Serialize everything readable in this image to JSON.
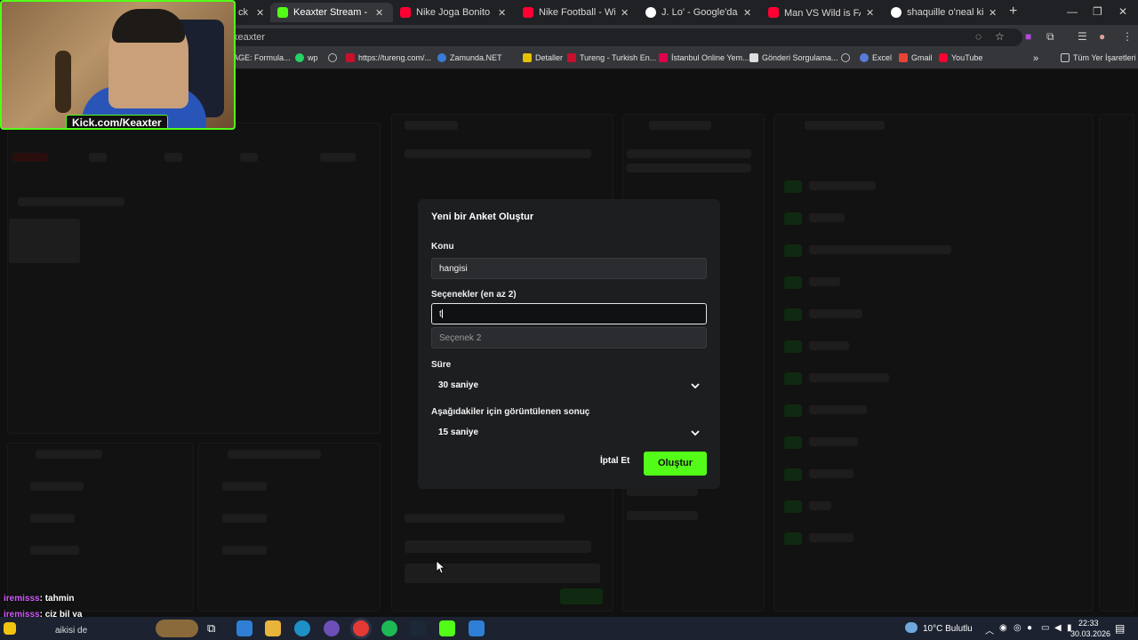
{
  "browser": {
    "tabs": [
      {
        "title": "Keaxter Stream - Kick Dash",
        "fav": "kick-icon",
        "color": "#53fc18",
        "active": true
      },
      {
        "title": "Nike Joga Bonito - Brazil",
        "fav": "youtube-icon",
        "color": "#ff0033",
        "active": false
      },
      {
        "title": "Nike Football - Winner Stays",
        "fav": "youtube-icon",
        "color": "#ff0033",
        "active": false
      },
      {
        "title": "J. Lo' - Google'da Ara",
        "fav": "google-icon",
        "color": "#ffffff",
        "active": false
      },
      {
        "title": "Man VS Wild is FAKE 😂😂",
        "fav": "youtube-icon",
        "color": "#ff0033",
        "active": false
      },
      {
        "title": "shaquille o'neal kilo - Goo",
        "fav": "google-icon",
        "color": "#ffffff",
        "active": false
      }
    ],
    "first_tab_fragment": "ck",
    "address": "keaxter",
    "bookmarks": [
      {
        "label": "AGE: Formula...",
        "icon": "page-icon"
      },
      {
        "label": "wp",
        "icon": "whatsapp-icon"
      },
      {
        "label": "",
        "icon": "globe-icon"
      },
      {
        "label": "https://tureng.com/...",
        "icon": "tureng-icon"
      },
      {
        "label": "Zamunda.NET",
        "icon": "zamunda-icon"
      },
      {
        "label": "Detaller",
        "icon": "folder-icon"
      },
      {
        "label": "Tureng - Turkish En...",
        "icon": "tureng-icon"
      },
      {
        "label": "İstanbul Online Yem...",
        "icon": "yemeksepeti-icon"
      },
      {
        "label": "Gönderi Sorgulama...",
        "icon": "mail-icon"
      },
      {
        "label": "",
        "icon": "globe-icon"
      },
      {
        "label": "Excel",
        "icon": "globe-icon"
      },
      {
        "label": "Gmail",
        "icon": "gmail-icon"
      },
      {
        "label": "YouTube",
        "icon": "youtube-icon"
      }
    ],
    "bookmarks_other": "Tüm Yer İşaretleri"
  },
  "webcam": {
    "label": "Kick.com/Keaxter"
  },
  "poll_modal": {
    "title": "Yeni bir Anket Oluştur",
    "topic_label": "Konu",
    "topic_value": "hangisi",
    "options_label": "Seçenekler (en az 2)",
    "option1_value": "t",
    "option2_placeholder": "Seçenek 2",
    "duration_label": "Süre",
    "duration_value": "30 saniye",
    "result_label": "Aşağıdakiler için görüntülenen sonuç",
    "result_value": "15 saniye",
    "cancel_label": "İptal Et",
    "create_label": "Oluştur"
  },
  "chat_overlay": [
    {
      "user": "iremisss",
      "text": ": tahmin"
    },
    {
      "user": "iremisss",
      "text": ": çiz bil ya"
    }
  ],
  "chat_partial": "aikisi de",
  "taskbar": {
    "weather": "10°C  Bulutlu",
    "time": "22:33",
    "date": "30.03.2026"
  },
  "colors": {
    "accent": "#53fc18",
    "modal_bg": "#1d1e20"
  }
}
